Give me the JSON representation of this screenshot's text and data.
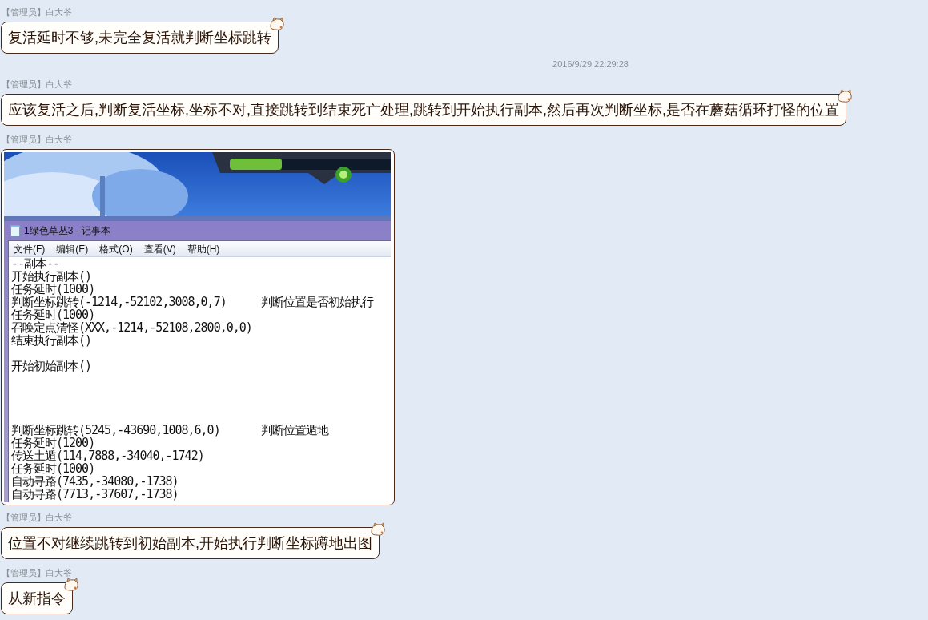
{
  "messages": [
    {
      "kind": "text",
      "sender_role": "【管理员】",
      "sender_name": "白大爷",
      "text": "复活延时不够,未完全复活就判断坐标跳转"
    },
    {
      "kind": "time",
      "text": "2016/9/29 22:29:28"
    },
    {
      "kind": "text",
      "sender_role": "【管理员】",
      "sender_name": "白大爷",
      "text": "应该复活之后,判断复活坐标,坐标不对,直接跳转到结束死亡处理,跳转到开始执行副本,然后再次判断坐标,是否在蘑菇循环打怪的位置"
    },
    {
      "kind": "screenshot",
      "sender_role": "【管理员】",
      "sender_name": "白大爷",
      "notepad": {
        "title": "1绿色草丛3 - 记事本",
        "menu": [
          "文件(F)",
          "编辑(E)",
          "格式(O)",
          "查看(V)",
          "帮助(H)"
        ],
        "lines": [
          {
            "kind": "code",
            "code": "--副本--"
          },
          {
            "kind": "code",
            "code": "开始执行副本()"
          },
          {
            "kind": "code",
            "code": "任务延时(1000)"
          },
          {
            "kind": "code",
            "code": "判断坐标跳转(-1214,-52102,3008,0,7)",
            "comment": "判断位置是否初始执行"
          },
          {
            "kind": "code",
            "code": "任务延时(1000)"
          },
          {
            "kind": "code",
            "code": "召唤定点清怪(XXX,-1214,-52108,2800,0,0)"
          },
          {
            "kind": "code",
            "code": "结束执行副本()"
          },
          {
            "kind": "blank"
          },
          {
            "kind": "code",
            "code": "开始初始副本()"
          },
          {
            "kind": "blank"
          },
          {
            "kind": "blank"
          },
          {
            "kind": "blank"
          },
          {
            "kind": "blank"
          },
          {
            "kind": "code",
            "code": "判断坐标跳转(5245,-43690,1008,6,0)",
            "comment": "判断位置遁地"
          },
          {
            "kind": "code",
            "code": "任务延时(1200)"
          },
          {
            "kind": "code",
            "code": "传送土遁(114,7888,-34040,-1742)"
          },
          {
            "kind": "code",
            "code": "任务延时(1000)"
          },
          {
            "kind": "code",
            "code": "自动寻路(7435,-34080,-1738)"
          },
          {
            "kind": "code",
            "code": "自动寻路(7713,-37607,-1738)"
          }
        ]
      }
    },
    {
      "kind": "text",
      "sender_role": "【管理员】",
      "sender_name": "白大爷",
      "text": "位置不对继续跳转到初始副本,开始执行判断坐标蹲地出图"
    },
    {
      "kind": "text",
      "sender_role": "【管理员】",
      "sender_name": "白大爷",
      "text": "从新指令"
    }
  ]
}
